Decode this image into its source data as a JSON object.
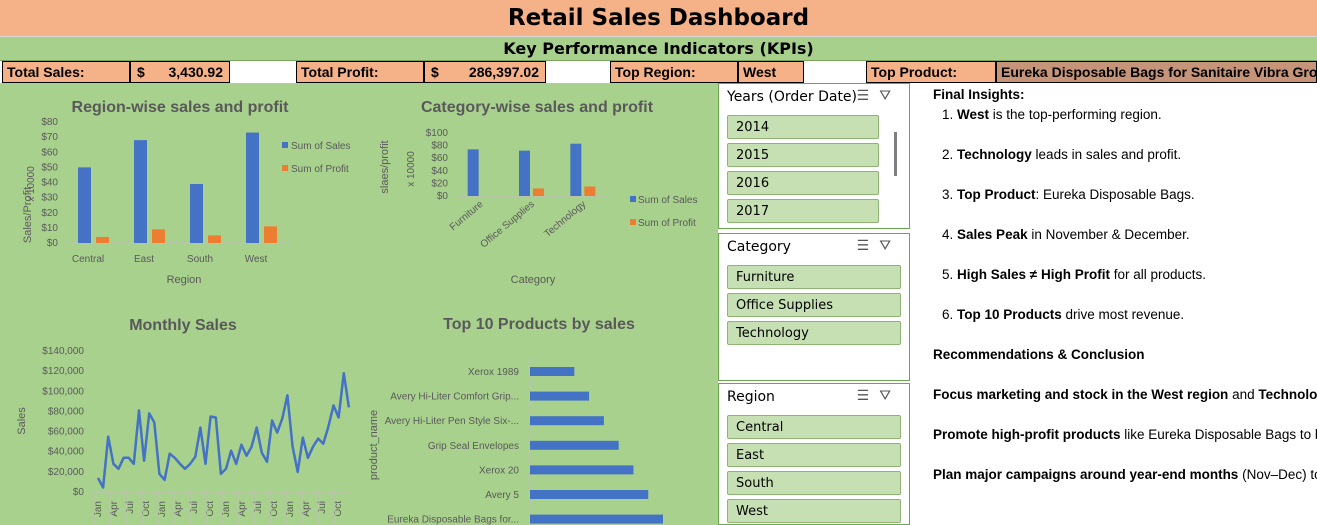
{
  "title": "Retail Sales Dashboard",
  "kpi_header": "Key Performance Indicators (KPIs)",
  "kpis": {
    "total_sales_label": "Total Sales:",
    "total_sales_currency": "$",
    "total_sales_value": "3,430.92",
    "total_profit_label": "Total Profit:",
    "total_profit_currency": "$",
    "total_profit_value": "286,397.02",
    "top_region_label": "Top Region:",
    "top_region_value": "West",
    "top_product_label": "Top Product:",
    "top_product_value": "Eureka Disposable Bags for Sanitaire Vibra Gro"
  },
  "chart_data": [
    {
      "type": "bar",
      "title": "Region-wise sales and profit",
      "xlabel": "Region",
      "ylabel": "Sales/Profit",
      "unit_label": "x 10000",
      "categories": [
        "Central",
        "East",
        "South",
        "West"
      ],
      "yticks": [
        "$0",
        "$10",
        "$20",
        "$30",
        "$40",
        "$50",
        "$60",
        "$70",
        "$80"
      ],
      "ylim": [
        0,
        80
      ],
      "series": [
        {
          "name": "Sum of Sales",
          "values": [
            50,
            68,
            39,
            73
          ],
          "color": "#4472c4"
        },
        {
          "name": "Sum of Profit",
          "values": [
            4,
            9,
            5,
            11
          ],
          "color": "#ed7d31"
        }
      ],
      "legend": "right"
    },
    {
      "type": "bar",
      "title": "Category-wise sales and profit",
      "xlabel": "Category",
      "ylabel": "slaes/profit",
      "unit_label": "x 10000",
      "categories": [
        "Furniture",
        "Office Supplies",
        "Technology"
      ],
      "yticks": [
        "$0",
        "$20",
        "$40",
        "$60",
        "$80",
        "$100"
      ],
      "ylim": [
        0,
        100
      ],
      "series": [
        {
          "name": "Sum of Sales",
          "values": [
            74,
            72,
            83
          ],
          "color": "#4472c4"
        },
        {
          "name": "Sum of Profit",
          "values": [
            0,
            12,
            15
          ],
          "color": "#ed7d31"
        }
      ],
      "legend": "right"
    },
    {
      "type": "line",
      "title": "Monthly Sales",
      "ylabel": "Sales",
      "yticks": [
        "$0",
        "$20,000",
        "$40,000",
        "$60,000",
        "$80,000",
        "$100,000",
        "$120,000",
        "$140,000"
      ],
      "ylim": [
        0,
        140000
      ],
      "xticks": [
        "Jan",
        "Apr",
        "Jul",
        "Oct",
        "Jan",
        "Apr",
        "Jul",
        "Oct",
        "Jan",
        "Apr",
        "Jul",
        "Oct",
        "Jan",
        "Apr",
        "Jul",
        "Oct"
      ],
      "values": [
        14000,
        4500,
        55000,
        28000,
        23000,
        34000,
        34000,
        28000,
        81000,
        31000,
        78000,
        69000,
        18000,
        12000,
        38000,
        34000,
        28000,
        23000,
        28000,
        35000,
        64000,
        28000,
        75000,
        74000,
        18000,
        23000,
        41000,
        28000,
        47000,
        36000,
        45000,
        64000,
        39000,
        30000,
        71000,
        59000,
        73000,
        96000,
        45000,
        20000,
        54000,
        34000,
        45000,
        53000,
        48000,
        65000,
        86000,
        74000,
        118000,
        84000
      ],
      "color": "#4472c4"
    },
    {
      "type": "bar",
      "orientation": "horizontal",
      "title": "Top 10 Products by sales",
      "ylabel": "product_name",
      "categories": [
        "Xerox 1989",
        "Avery Hi-Liter Comfort Grip...",
        "Avery Hi-Liter Pen Style Six-...",
        "Grip Seal Envelopes",
        "Xerox 20",
        "Avery 5",
        "Eureka Disposable Bags for..."
      ],
      "values": [
        300,
        400,
        500,
        600,
        700,
        800,
        900
      ],
      "color": "#4472c4"
    }
  ],
  "slicers": {
    "years": {
      "title": "Years (Order Date)",
      "items": [
        "2014",
        "2015",
        "2016",
        "2017"
      ]
    },
    "category": {
      "title": "Category",
      "items": [
        "Furniture",
        "Office Supplies",
        "Technology"
      ]
    },
    "region": {
      "title": "Region",
      "items": [
        "Central",
        "East",
        "South",
        "West"
      ]
    }
  },
  "insights": {
    "heading": "Final Insights:",
    "points": [
      {
        "num": "1.",
        "bold": "West",
        "rest": " is the top-performing region."
      },
      {
        "num": "2.",
        "bold": "Technology",
        "rest": " leads in sales and profit."
      },
      {
        "num": "3.",
        "bold": "Top Product",
        "rest": ": Eureka Disposable Bags."
      },
      {
        "num": "4.",
        "bold": "Sales Peak",
        "rest": " in November & December."
      },
      {
        "num": "5.",
        "bold": "High Sales ≠ High Profit",
        "rest": " for all products."
      },
      {
        "num": "6.",
        "bold": "Top 10 Products",
        "rest": " drive most revenue."
      }
    ],
    "rec_heading": "Recommendations & Conclusion",
    "recommendations": [
      {
        "bold": "Focus marketing and stock in the West region",
        "rest": " and ",
        "bold2": "Technology c"
      },
      {
        "bold": "Promote high-profit products",
        "rest": " like Eureka Disposable Bags to bo",
        "bold2": ""
      },
      {
        "bold": "Plan major campaigns around year-end months",
        "rest": " (Nov–Dec) to le",
        "bold2": ""
      }
    ]
  }
}
